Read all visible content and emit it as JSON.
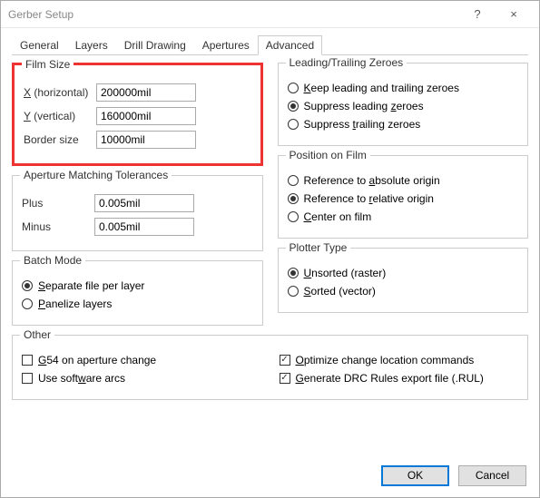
{
  "window": {
    "title": "Gerber Setup",
    "help": "?",
    "close": "×"
  },
  "tabs": [
    "General",
    "Layers",
    "Drill Drawing",
    "Apertures",
    "Advanced"
  ],
  "activeTab": 4,
  "filmSize": {
    "title": "Film Size",
    "x_label": "X (horizontal)",
    "y_label": "Y (vertical)",
    "border_label": "Border size",
    "x": "200000mil",
    "y": "160000mil",
    "border": "10000mil"
  },
  "apertureTol": {
    "title": "Aperture Matching Tolerances",
    "plus_label": "Plus",
    "minus_label": "Minus",
    "plus": "0.005mil",
    "minus": "0.005mil"
  },
  "batch": {
    "title": "Batch Mode",
    "separate": "Separate file per layer",
    "panelize": "Panelize layers",
    "selected": "separate"
  },
  "zeroes": {
    "title": "Leading/Trailing Zeroes",
    "keep": "Keep leading and trailing zeroes",
    "suppLead": "Suppress leading zeroes",
    "suppTrail": "Suppress trailing zeroes",
    "selected": "suppLead"
  },
  "position": {
    "title": "Position on Film",
    "absolute": "Reference to absolute origin",
    "relative": "Reference to relative origin",
    "center": "Center on film",
    "selected": "relative"
  },
  "plotter": {
    "title": "Plotter Type",
    "unsorted": "Unsorted (raster)",
    "sorted": "Sorted (vector)",
    "selected": "unsorted"
  },
  "other": {
    "title": "Other",
    "g54": "G54 on aperture change",
    "arcs": "Use software arcs",
    "optimize": "Optimize change location commands",
    "rul": "Generate DRC Rules export file (.RUL)",
    "g54_checked": false,
    "arcs_checked": false,
    "optimize_checked": true,
    "rul_checked": true
  },
  "buttons": {
    "ok": "OK",
    "cancel": "Cancel"
  }
}
